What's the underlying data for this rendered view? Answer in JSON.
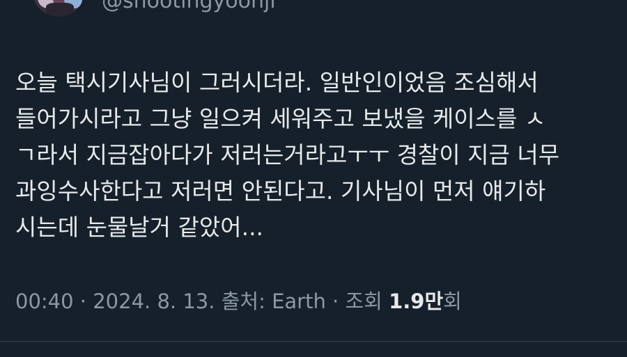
{
  "author": {
    "handle": "@shootingyoonji"
  },
  "tweet": {
    "lines": [
      "오늘 택시기사님이 그러시더라. 일반인이었음 조심해서",
      "들어가시라고 그냥 일으켜 세워주고 보냈을 케이스를 ㅅ",
      "ㄱ라서 지금잡아다가 저러는거라고ㅜㅜ 경찰이 지금 너무",
      "과잉수사한다고 저러면 안된다고. 기사님이 먼저 얘기하",
      "시는데 눈물날거 같았어..."
    ]
  },
  "meta": {
    "time": "00:40",
    "separator1": " · ",
    "date": "2024. 8. 13.",
    "source_label": " 출처: ",
    "source": "Earth",
    "separator2": " · ",
    "views_label": "조회 ",
    "views_count": "1.9만",
    "views_suffix": "회"
  }
}
